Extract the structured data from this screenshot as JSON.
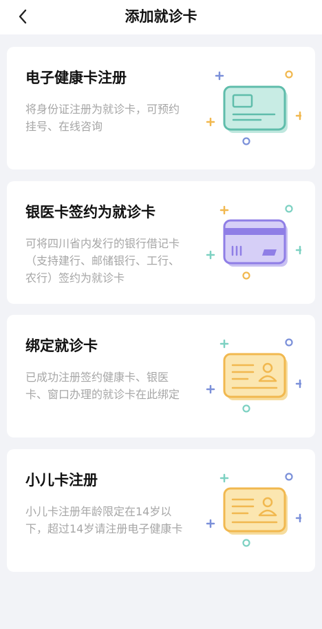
{
  "header": {
    "title": "添加就诊卡",
    "back_icon": "chevron-left-icon"
  },
  "cards": [
    {
      "title": "电子健康卡注册",
      "description": "将身份证注册为就诊卡，可预约挂号、在线咨询",
      "icon": "health-card-icon",
      "color": "#5fbdab"
    },
    {
      "title": "银医卡签约为就诊卡",
      "description": "可将四川省内发行的银行借记卡（支持建行、邮储银行、工行、农行）签约为就诊卡",
      "icon": "bank-card-icon",
      "color": "#8f7ee6"
    },
    {
      "title": "绑定就诊卡",
      "description": "已成功注册签约健康卡、银医卡、窗口办理的就诊卡在此绑定",
      "icon": "id-card-icon",
      "color": "#f1b84f"
    },
    {
      "title": "小儿卡注册",
      "description": "小儿卡注册年龄限定在14岁以下，超过14岁请注册电子健康卡",
      "icon": "id-card-icon",
      "color": "#f1b84f"
    }
  ]
}
